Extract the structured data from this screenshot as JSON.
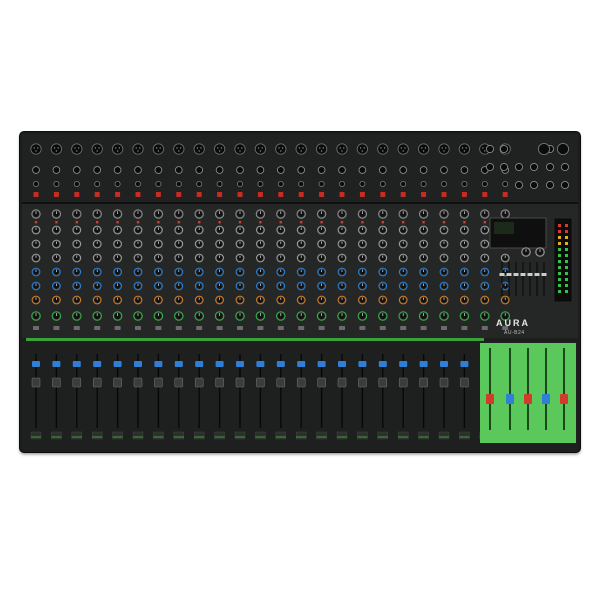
{
  "product": {
    "brand": "AURA",
    "model": "AU-B24"
  },
  "channels": {
    "count": 24
  },
  "master_section": {
    "group_faders": 4,
    "stereo_faders": 2
  },
  "colors": {
    "body": "#1c1d1d",
    "accent_green": "#3aa23a",
    "master_green": "#5ac85a",
    "knob_red": "#c0392b",
    "knob_blue": "#2a7fd0",
    "knob_orange": "#d07a20",
    "knob_green": "#34b044",
    "fader_red": "#d23a2a",
    "fader_blue": "#2f7fd6"
  }
}
